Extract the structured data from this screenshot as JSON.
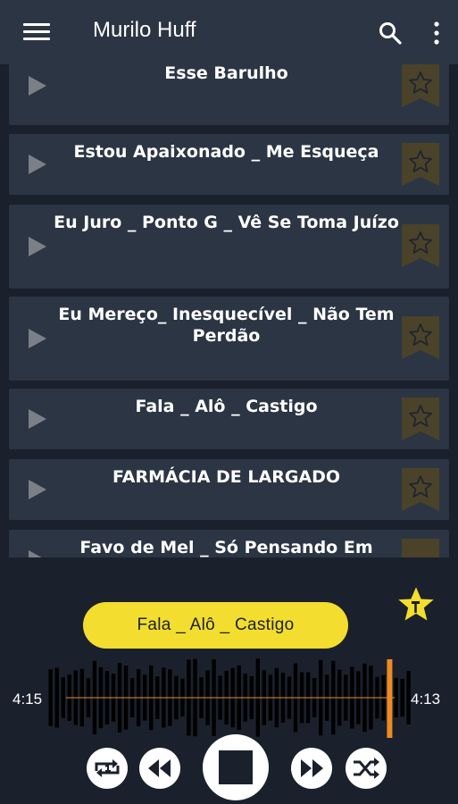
{
  "app": {
    "title": "Murilo Huff"
  },
  "songs": [
    {
      "title": "Esse Barulho"
    },
    {
      "title": "Estou Apaixonado _ Me Esqueça"
    },
    {
      "title": "Eu Juro _ Ponto G _ Vê Se Toma Juízo"
    },
    {
      "title": "Eu Mereço_ Inesquecível _ Não Tem Perdão"
    },
    {
      "title": "Fala _ Alô _ Castigo"
    },
    {
      "title": "FARMÁCIA DE LARGADO"
    },
    {
      "title": "Favo de Mel _ Só Pensando Em"
    }
  ],
  "player": {
    "now_playing": "Fala _ Alô _ Castigo",
    "elapsed": "4:15",
    "remaining": "4:13",
    "progress": 0.93
  },
  "icons": {
    "menu": "menu-icon",
    "search": "search-icon",
    "more": "more-vert-icon",
    "play": "play-icon",
    "favorite": "star-icon",
    "repeat_one": "repeat-one-icon",
    "rewind": "rewind-icon",
    "stop": "stop-icon",
    "fast_forward": "fast-forward-icon",
    "shuffle": "shuffle-icon"
  },
  "colors": {
    "background": "#1a212c",
    "card": "#2c3543",
    "accent": "#f3dd2e",
    "progress": "#f08a24"
  }
}
